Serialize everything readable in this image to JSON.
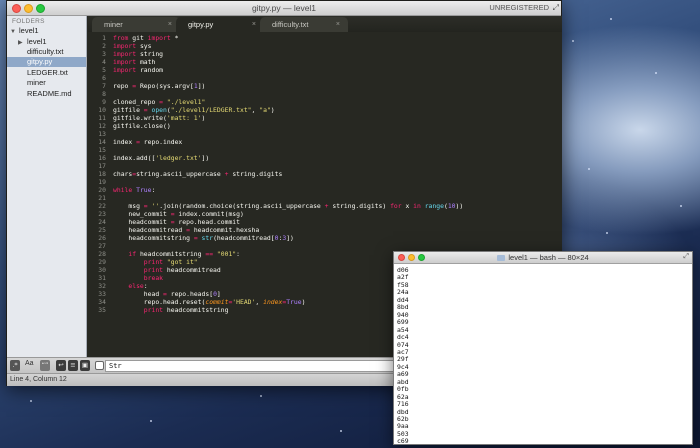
{
  "sublime": {
    "title": "gitpy.py — level1",
    "unregistered": "UNREGISTERED",
    "sidebar": {
      "header": "FOLDERS",
      "items": [
        {
          "label": "level1",
          "type": "folder-open"
        },
        {
          "label": "level1",
          "type": "folder-closed"
        },
        {
          "label": "difficulty.txt",
          "type": "file"
        },
        {
          "label": "gitpy.py",
          "type": "file",
          "selected": true
        },
        {
          "label": "LEDGER.txt",
          "type": "file"
        },
        {
          "label": "miner",
          "type": "file"
        },
        {
          "label": "README.md",
          "type": "file"
        }
      ]
    },
    "tabs": [
      {
        "label": "miner",
        "close": "×"
      },
      {
        "label": "gitpy.py",
        "close": "×",
        "active": true
      },
      {
        "label": "difficulty.txt",
        "close": "×"
      }
    ],
    "code": [
      [
        [
          "kw",
          "from "
        ],
        [
          "tx",
          "git "
        ],
        [
          "kw",
          "import "
        ],
        [
          "tx",
          "*"
        ]
      ],
      [
        [
          "kw",
          "import "
        ],
        [
          "tx",
          "sys"
        ]
      ],
      [
        [
          "kw",
          "import "
        ],
        [
          "tx",
          "string"
        ]
      ],
      [
        [
          "kw",
          "import "
        ],
        [
          "tx",
          "math"
        ]
      ],
      [
        [
          "kw",
          "import "
        ],
        [
          "tx",
          "random"
        ]
      ],
      [],
      [
        [
          "tx",
          "repo "
        ],
        [
          "kw",
          "= "
        ],
        [
          "tx",
          "Repo(sys.argv["
        ],
        [
          "nm",
          "1"
        ],
        [
          "tx",
          "])"
        ]
      ],
      [],
      [
        [
          "tx",
          "cloned_repo "
        ],
        [
          "kw",
          "= "
        ],
        [
          "st",
          "\"./level1\""
        ]
      ],
      [
        [
          "tx",
          "gitfile "
        ],
        [
          "kw",
          "= "
        ],
        [
          "fn",
          "open"
        ],
        [
          "tx",
          "("
        ],
        [
          "st",
          "\"./level1/LEDGER.txt\""
        ],
        [
          "tx",
          ", "
        ],
        [
          "st",
          "\"a\""
        ],
        [
          "tx",
          ")"
        ]
      ],
      [
        [
          "tx",
          "gitfile.write("
        ],
        [
          "st",
          "'matt: 1'"
        ],
        [
          "tx",
          ")"
        ]
      ],
      [
        [
          "tx",
          "gitfile.close()"
        ]
      ],
      [],
      [
        [
          "tx",
          "index "
        ],
        [
          "kw",
          "= "
        ],
        [
          "tx",
          "repo.index"
        ]
      ],
      [],
      [
        [
          "tx",
          "index.add(["
        ],
        [
          "st",
          "'ledger.txt'"
        ],
        [
          "tx",
          "])"
        ]
      ],
      [],
      [
        [
          "tx",
          "chars"
        ],
        [
          "kw",
          "="
        ],
        [
          "tx",
          "string.ascii_uppercase "
        ],
        [
          "kw",
          "+ "
        ],
        [
          "tx",
          "string.digits"
        ]
      ],
      [],
      [
        [
          "kw",
          "while "
        ],
        [
          "nm",
          "True"
        ],
        [
          "tx",
          ":"
        ]
      ],
      [],
      [
        [
          "tx",
          "    msg "
        ],
        [
          "kw",
          "= "
        ],
        [
          "st",
          "''"
        ],
        [
          "tx",
          ".join(random.choice(string.ascii_uppercase "
        ],
        [
          "kw",
          "+ "
        ],
        [
          "tx",
          "string.digits) "
        ],
        [
          "kw",
          "for "
        ],
        [
          "tx",
          "x "
        ],
        [
          "kw",
          "in "
        ],
        [
          "fn",
          "range"
        ],
        [
          "tx",
          "("
        ],
        [
          "nm",
          "10"
        ],
        [
          "tx",
          "))"
        ]
      ],
      [
        [
          "tx",
          "    new_commit "
        ],
        [
          "kw",
          "= "
        ],
        [
          "tx",
          "index.commit(msg)"
        ]
      ],
      [
        [
          "tx",
          "    headcommit "
        ],
        [
          "kw",
          "= "
        ],
        [
          "tx",
          "repo.head.commit"
        ]
      ],
      [
        [
          "tx",
          "    headcommitread "
        ],
        [
          "kw",
          "= "
        ],
        [
          "tx",
          "headcommit.hexsha"
        ]
      ],
      [
        [
          "tx",
          "    headcommitstring "
        ],
        [
          "kw",
          "= "
        ],
        [
          "fn",
          "str"
        ],
        [
          "tx",
          "(headcommitread["
        ],
        [
          "nm",
          "0"
        ],
        [
          "tx",
          ":"
        ],
        [
          "nm",
          "3"
        ],
        [
          "tx",
          "])"
        ]
      ],
      [],
      [
        [
          "tx",
          "    "
        ],
        [
          "kw",
          "if "
        ],
        [
          "tx",
          "headcommitstring "
        ],
        [
          "kw",
          "== "
        ],
        [
          "st",
          "\"001\""
        ],
        [
          "tx",
          ":"
        ]
      ],
      [
        [
          "tx",
          "        "
        ],
        [
          "kw",
          "print "
        ],
        [
          "st",
          "\"got it\""
        ]
      ],
      [
        [
          "tx",
          "        "
        ],
        [
          "kw",
          "print "
        ],
        [
          "tx",
          "headcommitread"
        ]
      ],
      [
        [
          "tx",
          "        "
        ],
        [
          "kw",
          "break"
        ]
      ],
      [
        [
          "tx",
          "    "
        ],
        [
          "kw",
          "else"
        ],
        [
          "tx",
          ":"
        ]
      ],
      [
        [
          "tx",
          "        head "
        ],
        [
          "kw",
          "= "
        ],
        [
          "tx",
          "repo.heads["
        ],
        [
          "nm",
          "0"
        ],
        [
          "tx",
          "]"
        ]
      ],
      [
        [
          "tx",
          "        repo.head.reset("
        ],
        [
          "pr",
          "commit"
        ],
        [
          "kw",
          "="
        ],
        [
          "st",
          "'HEAD'"
        ],
        [
          "tx",
          ", "
        ],
        [
          "pr",
          "index"
        ],
        [
          "kw",
          "="
        ],
        [
          "nm",
          "True"
        ],
        [
          "tx",
          ")"
        ]
      ],
      [
        [
          "tx",
          "        "
        ],
        [
          "kw",
          "print "
        ],
        [
          "tx",
          "headcommitstring"
        ]
      ]
    ],
    "findbar": {
      "aa_label": "Aa",
      "query": "Str"
    },
    "status": "Line 4, Column 12"
  },
  "terminal": {
    "title": "level1 — bash — 80×24",
    "lines": [
      "d06",
      "a2f",
      "f58",
      "24a",
      "dd4",
      "8bd",
      "940",
      "699",
      "a54",
      "dc4",
      "074",
      "ac7",
      "29f",
      "9c4",
      "a69",
      "abd",
      "0fb",
      "62a",
      "716",
      "dbd",
      "62b",
      "9aa",
      "503",
      "c69"
    ]
  },
  "colors": {
    "editor_bg": "#272822",
    "keyword": "#f92672",
    "string": "#e6db74",
    "number": "#ae81ff",
    "function": "#66d9ef"
  }
}
